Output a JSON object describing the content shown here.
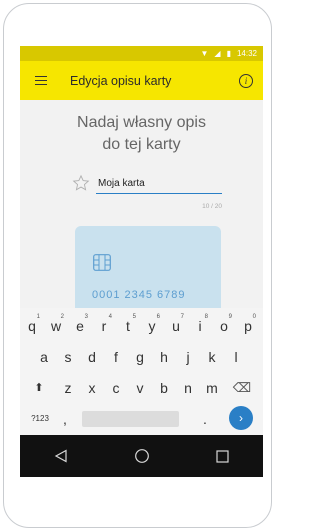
{
  "statusbar": {
    "time": "14:32",
    "wifi_icon": "▼",
    "signal_icon": "◢",
    "battery_icon": "▮"
  },
  "appbar": {
    "title": "Edycja opisu karty",
    "info_icon": "i"
  },
  "main": {
    "heading_line1": "Nadaj własny opis",
    "heading_line2": "do tej karty",
    "description_value": "Moja karta",
    "counter": "10 / 20"
  },
  "card": {
    "number": "0001 2345 6789"
  },
  "keyboard": {
    "row1": [
      "q",
      "w",
      "e",
      "r",
      "t",
      "y",
      "u",
      "i",
      "o",
      "p"
    ],
    "row1_hints": [
      "1",
      "2",
      "3",
      "4",
      "5",
      "6",
      "7",
      "8",
      "9",
      "0"
    ],
    "row2": [
      "a",
      "s",
      "d",
      "f",
      "g",
      "h",
      "j",
      "k",
      "l"
    ],
    "row3": [
      "z",
      "x",
      "c",
      "v",
      "b",
      "n",
      "m"
    ],
    "shift_icon": "⬆",
    "backspace_icon": "⌫",
    "symbols_label": "?123",
    "comma": ",",
    "period": ".",
    "enter_icon": "›"
  },
  "colors": {
    "statusbar": "#d8c800",
    "appbar": "#f6e600",
    "accent": "#2a7fc6",
    "card": "#c9e1ee"
  }
}
